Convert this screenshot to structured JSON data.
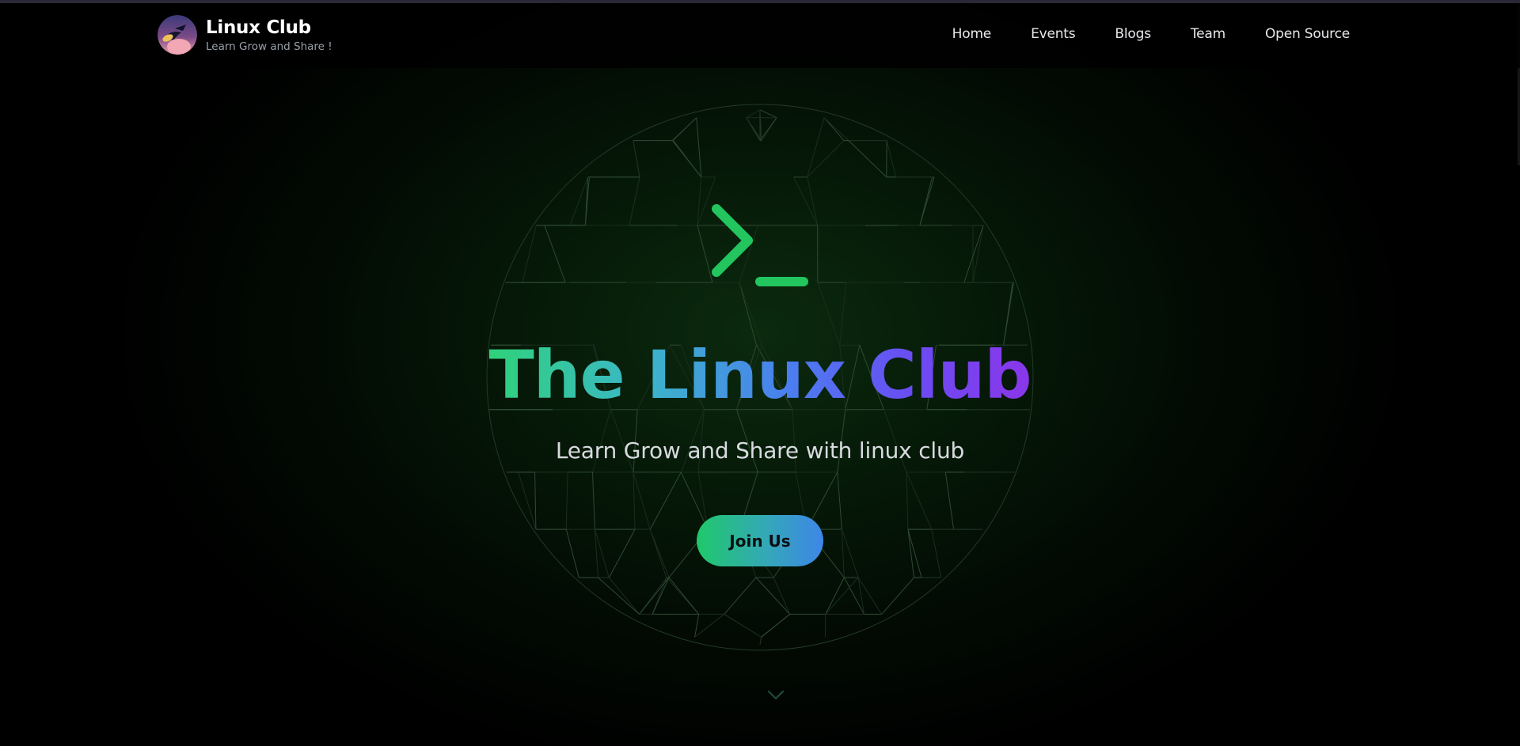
{
  "brand": {
    "title": "Linux Club",
    "tagline": "Learn Grow and Share !"
  },
  "nav": {
    "items": [
      {
        "label": "Home"
      },
      {
        "label": "Events"
      },
      {
        "label": "Blogs"
      },
      {
        "label": "Team"
      },
      {
        "label": "Open Source"
      }
    ]
  },
  "hero": {
    "icon": "terminal-prompt-icon",
    "title": "The Linux Club",
    "subtitle": "Learn Grow and Share with linux club",
    "cta_label": "Join Us",
    "scroll_icon": "chevron-down-icon"
  },
  "colors": {
    "accent_green": "#22c55e",
    "gradient_start": "#2fd27a",
    "gradient_mid": "#4a7ff0",
    "gradient_end": "#8b36ea",
    "background": "#000000"
  }
}
